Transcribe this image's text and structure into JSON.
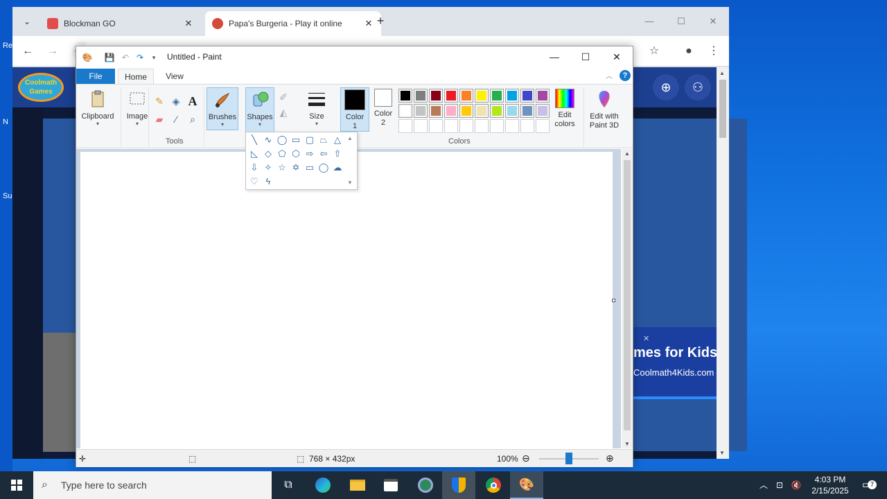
{
  "desktop": {
    "fragments": [
      "Re",
      "N",
      "Su"
    ]
  },
  "chrome": {
    "tabs": [
      {
        "title": "Blockman GO",
        "close": "✕"
      },
      {
        "title": "Papa's Burgeria - Play it online",
        "close": "✕"
      }
    ],
    "new_tab": "+",
    "window_controls": [
      "—",
      "☐",
      "✕"
    ],
    "omnibox_fragment": "C",
    "site": {
      "logo_text": "Coolmath Games",
      "ad_close": "✕",
      "ad_title": "mes for Kids",
      "ad_url": "Coolmath4Kids.com"
    }
  },
  "paint": {
    "window_title": "Untitled - Paint",
    "window_controls": [
      "—",
      "☐",
      "✕"
    ],
    "ribbon_tabs": {
      "file": "File",
      "home": "Home",
      "view": "View"
    },
    "help": "?",
    "groups": {
      "clipboard": "Clipboard",
      "image": "Image",
      "tools": "Tools",
      "brushes": "Brushes",
      "shapes": "Shapes",
      "size": "Size",
      "color1": [
        "Color",
        "1"
      ],
      "color2": [
        "Color",
        "2"
      ],
      "colors": "Colors",
      "edit_colors": [
        "Edit",
        "colors"
      ],
      "edit_3d": [
        "Edit with",
        "Paint 3D"
      ]
    },
    "palette_row1": [
      "#000000",
      "#7f7f7f",
      "#880015",
      "#ed1c24",
      "#ff7f27",
      "#fff200",
      "#22b14c",
      "#00a2e8",
      "#3f48cc",
      "#a349a4"
    ],
    "palette_row2": [
      "#ffffff",
      "#c3c3c3",
      "#b97a57",
      "#ffaec9",
      "#ffc90e",
      "#efe4b0",
      "#b5e61d",
      "#99d9ea",
      "#7092be",
      "#c8bfe7"
    ],
    "palette_row3_count": 10,
    "color1_value": "#000000",
    "color2_value": "#ffffff",
    "status": {
      "canvas_size": "768 × 432px",
      "zoom": "100%"
    }
  },
  "taskbar": {
    "search_placeholder": "Type here to search",
    "time": "4:03 PM",
    "date": "2/15/2025",
    "notification_count": "7"
  }
}
